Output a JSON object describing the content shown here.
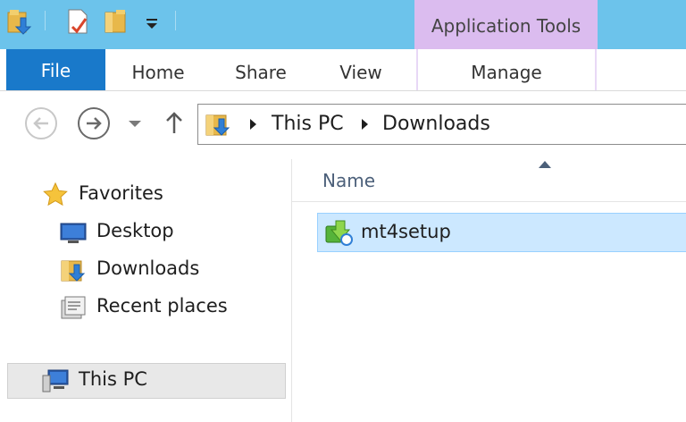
{
  "ribbon": {
    "contextual_group": "Application Tools",
    "tabs": {
      "file": "File",
      "home": "Home",
      "share": "Share",
      "view": "View",
      "manage": "Manage"
    }
  },
  "address_bar": {
    "crumbs": [
      "This PC",
      "Downloads"
    ]
  },
  "nav_pane": {
    "favorites": "Favorites",
    "desktop": "Desktop",
    "downloads": "Downloads",
    "recent_places": "Recent places",
    "this_pc": "This PC"
  },
  "content": {
    "column_header": "Name",
    "sort_direction": "ascending",
    "files": [
      {
        "name": "mt4setup",
        "selected": true,
        "icon": "installer-icon"
      }
    ]
  },
  "colors": {
    "title_bar": "#6cc3eb",
    "file_tab": "#1979ca",
    "contextual_tab": "#dbbcef",
    "selection": "#cce8ff",
    "selection_border": "#99d1ff"
  }
}
